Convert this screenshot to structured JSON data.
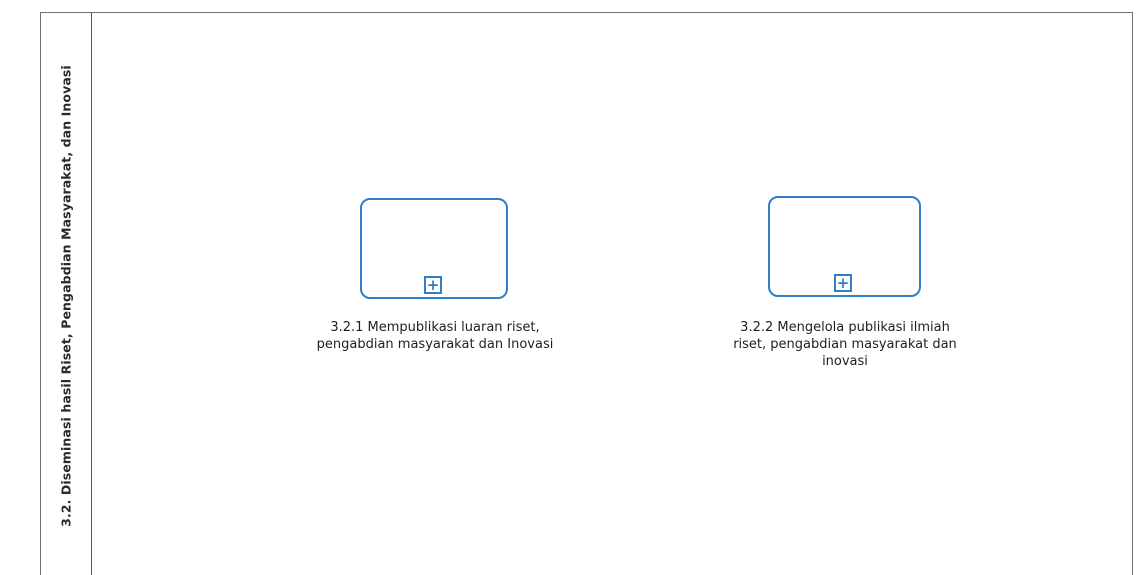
{
  "lane": {
    "title": "3.2. Diseminasi hasil Riset, Pengabdian Masyarakat, dan Inovasi"
  },
  "tasks": [
    {
      "label_line1": "3.2.1 Mempublikasi luaran riset,",
      "label_line2": "pengabdian masyarakat dan Inovasi",
      "marker_icon": "plus-icon"
    },
    {
      "label_line1": "3.2.2 Mengelola publikasi ilmiah",
      "label_line2": "riset, pengabdian masyarakat dan",
      "label_line3": "inovasi",
      "marker_icon": "plus-icon"
    }
  ],
  "colors": {
    "task_border": "#2f7fc8",
    "frame": "#6f6f6f",
    "text": "#1f1f1f"
  }
}
